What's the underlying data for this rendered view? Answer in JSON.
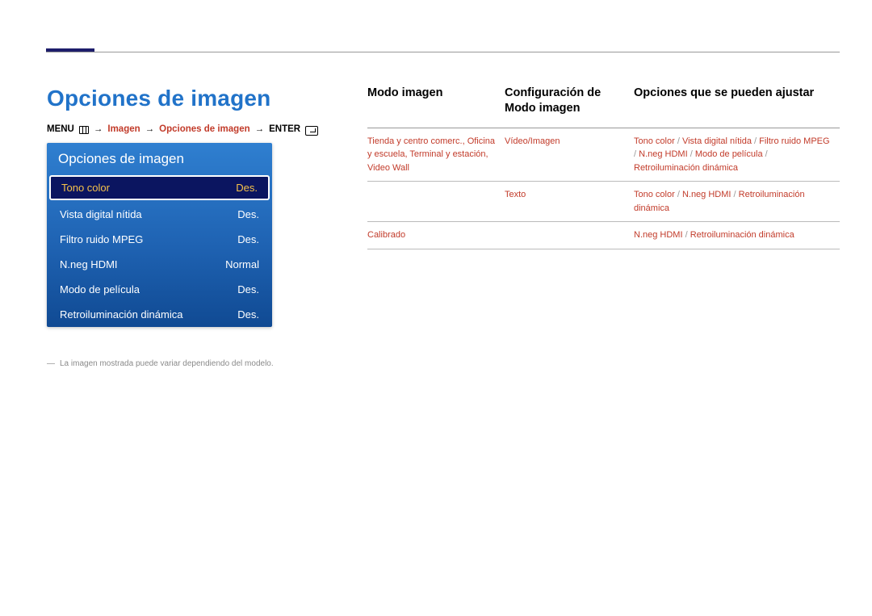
{
  "heading": "Opciones de imagen",
  "breadcrumb": {
    "menu": "MENU",
    "seg1": "Imagen",
    "seg2": "Opciones de imagen",
    "enter": "ENTER"
  },
  "osd": {
    "title": "Opciones de imagen",
    "items": [
      {
        "label": "Tono color",
        "value": "Des.",
        "selected": true
      },
      {
        "label": "Vista digital nítida",
        "value": "Des.",
        "selected": false
      },
      {
        "label": "Filtro ruido MPEG",
        "value": "Des.",
        "selected": false
      },
      {
        "label": "N.neg HDMI",
        "value": "Normal",
        "selected": false
      },
      {
        "label": "Modo de película",
        "value": "Des.",
        "selected": false
      },
      {
        "label": "Retroiluminación dinámica",
        "value": "Des.",
        "selected": false
      }
    ]
  },
  "footnote": {
    "mark": "―",
    "text": "La imagen mostrada puede variar dependiendo del modelo."
  },
  "table": {
    "headers": {
      "col1": "Modo imagen",
      "col2": "Configuración de Modo imagen",
      "col3": "Opciones que se pueden ajustar"
    },
    "rows": [
      {
        "c1": [
          "Tienda y centro comerc.",
          "Oficina y escuela",
          "Terminal y estación",
          "Video Wall"
        ],
        "c2": [
          "Vídeo/Imagen"
        ],
        "c3": [
          "Tono color",
          "Vista digital nítida",
          "Filtro ruido MPEG",
          "N.neg HDMI",
          "Modo de película",
          "Retroiluminación dinámica"
        ]
      },
      {
        "c1": [],
        "c2": [
          "Texto"
        ],
        "c3": [
          "Tono color",
          "N.neg HDMI",
          "Retroiluminación dinámica"
        ]
      },
      {
        "c1": [
          "Calibrado"
        ],
        "c2": [],
        "c3": [
          "N.neg HDMI",
          "Retroiluminación dinámica"
        ]
      }
    ]
  }
}
